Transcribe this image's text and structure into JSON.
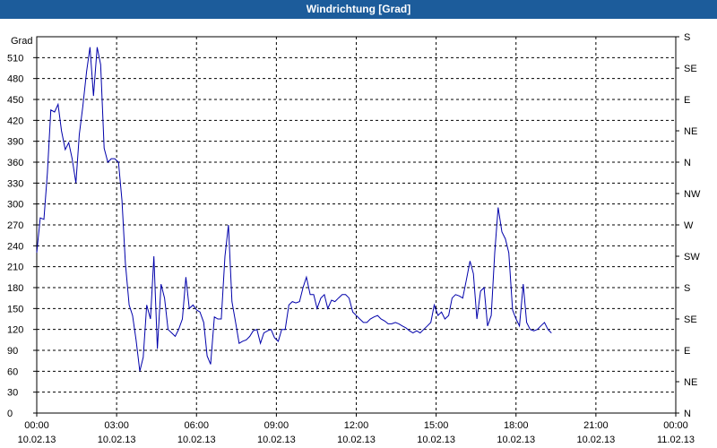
{
  "window": {
    "title": "Windrichtung [Grad]"
  },
  "chart_data": {
    "type": "line",
    "title": "Windrichtung [Grad]",
    "ylabel": "Grad",
    "ylim": [
      0,
      540
    ],
    "y_ticks": [
      0,
      30,
      60,
      90,
      120,
      150,
      180,
      210,
      240,
      270,
      300,
      330,
      360,
      390,
      420,
      450,
      480,
      510
    ],
    "y2_ticks": [
      {
        "value": 0,
        "label": "N"
      },
      {
        "value": 45,
        "label": "NE"
      },
      {
        "value": 90,
        "label": "E"
      },
      {
        "value": 135,
        "label": "SE"
      },
      {
        "value": 180,
        "label": "S"
      },
      {
        "value": 225,
        "label": "SW"
      },
      {
        "value": 270,
        "label": "W"
      },
      {
        "value": 315,
        "label": "NW"
      },
      {
        "value": 360,
        "label": "N"
      },
      {
        "value": 405,
        "label": "NE"
      },
      {
        "value": 450,
        "label": "E"
      },
      {
        "value": 495,
        "label": "SE"
      },
      {
        "value": 540,
        "label": "S"
      }
    ],
    "xlim": [
      0,
      24
    ],
    "x_ticks": [
      {
        "value": 0,
        "time": "00:00",
        "date": "10.02.13"
      },
      {
        "value": 3,
        "time": "03:00",
        "date": "10.02.13"
      },
      {
        "value": 6,
        "time": "06:00",
        "date": "10.02.13"
      },
      {
        "value": 9,
        "time": "09:00",
        "date": "10.02.13"
      },
      {
        "value": 12,
        "time": "12:00",
        "date": "10.02.13"
      },
      {
        "value": 15,
        "time": "15:00",
        "date": "10.02.13"
      },
      {
        "value": 18,
        "time": "18:00",
        "date": "10.02.13"
      },
      {
        "value": 21,
        "time": "21:00",
        "date": "10.02.13"
      },
      {
        "value": 24,
        "time": "00:00",
        "date": "11.02.13"
      }
    ],
    "grid": true,
    "line_color": "#0000aa",
    "x": [
      0,
      0.13,
      0.27,
      0.4,
      0.53,
      0.67,
      0.8,
      0.93,
      1.07,
      1.2,
      1.33,
      1.47,
      1.6,
      1.73,
      1.87,
      2.0,
      2.13,
      2.27,
      2.4,
      2.53,
      2.67,
      2.8,
      2.93,
      3.07,
      3.2,
      3.33,
      3.47,
      3.6,
      3.73,
      3.87,
      4.0,
      4.13,
      4.27,
      4.4,
      4.53,
      4.67,
      4.8,
      4.93,
      5.07,
      5.2,
      5.33,
      5.47,
      5.6,
      5.73,
      5.87,
      6.0,
      6.13,
      6.27,
      6.4,
      6.53,
      6.67,
      6.8,
      6.93,
      7.07,
      7.2,
      7.33,
      7.47,
      7.6,
      7.73,
      7.87,
      8.0,
      8.13,
      8.27,
      8.4,
      8.53,
      8.67,
      8.8,
      8.93,
      9.07,
      9.2,
      9.33,
      9.47,
      9.6,
      9.73,
      9.87,
      10.0,
      10.13,
      10.27,
      10.4,
      10.53,
      10.67,
      10.8,
      10.93,
      11.07,
      11.2,
      11.33,
      11.47,
      11.6,
      11.73,
      11.87,
      12.0,
      12.13,
      12.27,
      12.4,
      12.53,
      12.67,
      12.8,
      12.93,
      13.07,
      13.2,
      13.33,
      13.47,
      13.6,
      13.73,
      13.87,
      14.0,
      14.13,
      14.27,
      14.4,
      14.53,
      14.67,
      14.8,
      14.93,
      15.07,
      15.2,
      15.33,
      15.47,
      15.6,
      15.73,
      15.87,
      16.0,
      16.13,
      16.27,
      16.4,
      16.53,
      16.67,
      16.8,
      16.93,
      17.07,
      17.2,
      17.33,
      17.47,
      17.6,
      17.73,
      17.87,
      18.0,
      18.13,
      18.27,
      18.4,
      18.53,
      18.67,
      18.8,
      18.93,
      19.07,
      19.2,
      19.33,
      19.47,
      19.6,
      19.73,
      19.87,
      20.0,
      20.13,
      20.27,
      20.4,
      20.53,
      20.67,
      20.8,
      20.93,
      21.07,
      21.2,
      21.33,
      21.47,
      21.6,
      21.73,
      21.87,
      22.0,
      22.13,
      22.27,
      22.4,
      22.53,
      22.67,
      22.8,
      22.93,
      23.07,
      23.2,
      23.33,
      23.47,
      23.6,
      23.73,
      23.87,
      24.0
    ],
    "series": [
      {
        "values": [
          230,
          280,
          278,
          345,
          435,
          432,
          443,
          405,
          378,
          388,
          365,
          330,
          400,
          440,
          490,
          525,
          455,
          525,
          500,
          380,
          360,
          365,
          365,
          360,
          305,
          215,
          155,
          140,
          105,
          60,
          80,
          155,
          135,
          225,
          92,
          185,
          165,
          120,
          115,
          110,
          120,
          135,
          195,
          150,
          155,
          148,
          145,
          130,
          82,
          70,
          138,
          135,
          135,
          225,
          270,
          160,
          130,
          100,
          103,
          105,
          110,
          118,
          120,
          100,
          115,
          118,
          120,
          108,
          103,
          120,
          120,
          155,
          160,
          158,
          160,
          180,
          195,
          170,
          170,
          150,
          165,
          170,
          150,
          162,
          160,
          165,
          170,
          170,
          165,
          145,
          140,
          135,
          130,
          130,
          135,
          138,
          140,
          135,
          132,
          128,
          128,
          130,
          128,
          125,
          122,
          118,
          115,
          118,
          115,
          120,
          125,
          130,
          155,
          140,
          145,
          135,
          140,
          165,
          170,
          168,
          165,
          190,
          218,
          200,
          135,
          175,
          180,
          125,
          140,
          230,
          295,
          260,
          250,
          230,
          148,
          135,
          125,
          185,
          130,
          120,
          118,
          120,
          125,
          130,
          120,
          115
        ]
      }
    ]
  }
}
